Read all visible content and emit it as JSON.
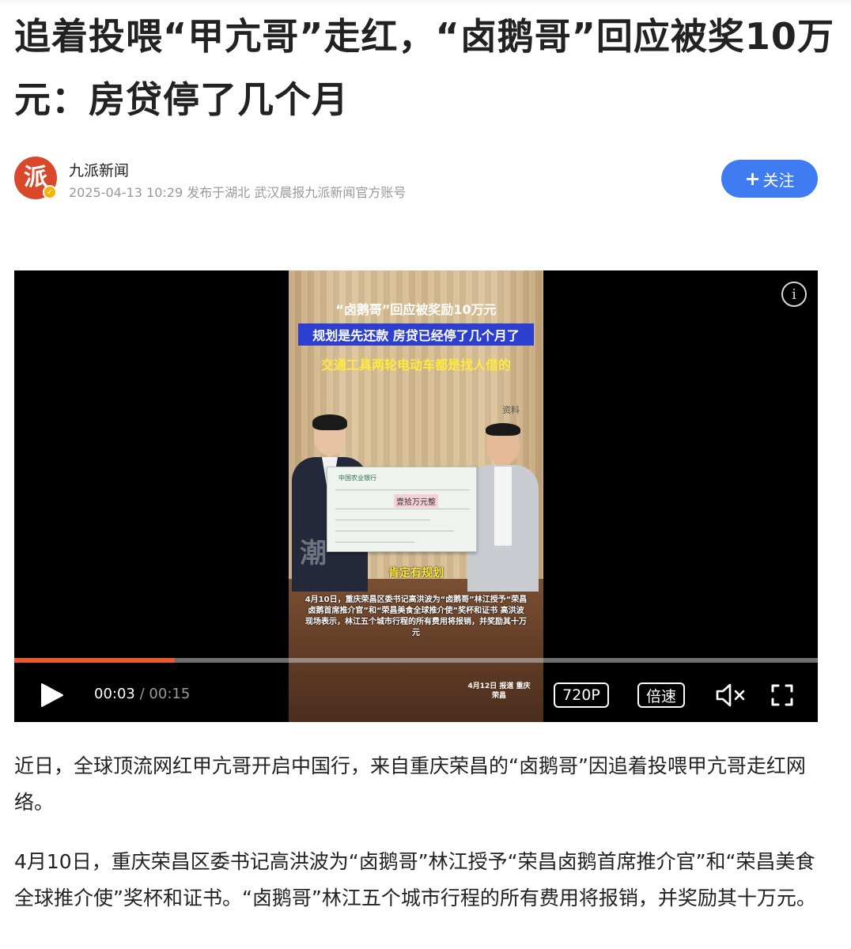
{
  "article": {
    "title": "追着投喂“甲亢哥”走红，“卤鹅哥”回应被奖10万元：房贷停了几个月"
  },
  "author": {
    "name": "九派新闻",
    "avatar_glyph": "派",
    "meta": "2025-04-13 10:29  发布于湖北  武汉晨报九派新闻官方账号",
    "follow_label": "关注",
    "follow_plus": "+"
  },
  "video": {
    "caption_top": "“卤鹅哥”回应被奖励10万元",
    "caption_mid": "规划是先还款 房贷已经停了几个月了",
    "caption_low": "交通工具两轮电动车都是找人借的",
    "corner_tag": "资料",
    "cheque_bank": "中国农业银行",
    "cheque_amount": "壹拾万元整",
    "watermark": "潮",
    "subtitle_main": "肯定有规划",
    "subtitle_detail": "4月10日，重庆荣昌区委书记高洪波为“卤鹅哥”林江授予“荣昌卤鹅首席推介官”和“荣昌美食全球推介使”奖杯和证书 高洪波现场表示，林江五个城市行程的所有费用将报销，并奖励其十万元",
    "report_tag": "4月12日 报道 重庆荣昌",
    "progress": 0.2,
    "time_current": "00:03",
    "time_separator": "/",
    "time_total": "00:15",
    "quality_label": "720P",
    "speed_label": "倍速",
    "info_glyph": "i",
    "icons": [
      "play-icon",
      "mute-icon",
      "fullscreen-icon",
      "info-icon"
    ],
    "accent_color": "#ea5a2f"
  },
  "body": {
    "paragraph_1": "近日，全球顶流网红甲亢哥开启中国行，来自重庆荣昌的“卤鹅哥”因追着投喂甲亢哥走红网络。",
    "paragraph_2": "4月10日，重庆荣昌区委书记高洪波为“卤鹅哥”林江授予“荣昌卤鹅首席推介官”和“荣昌美食全球推介使”奖杯和证书。“卤鹅哥”林江五个城市行程的所有费用将报销，并奖励其十万元。"
  },
  "colors": {
    "follow_button": "#3f7cf2",
    "avatar": "#d9482b",
    "verified_badge": "#f5b400"
  }
}
